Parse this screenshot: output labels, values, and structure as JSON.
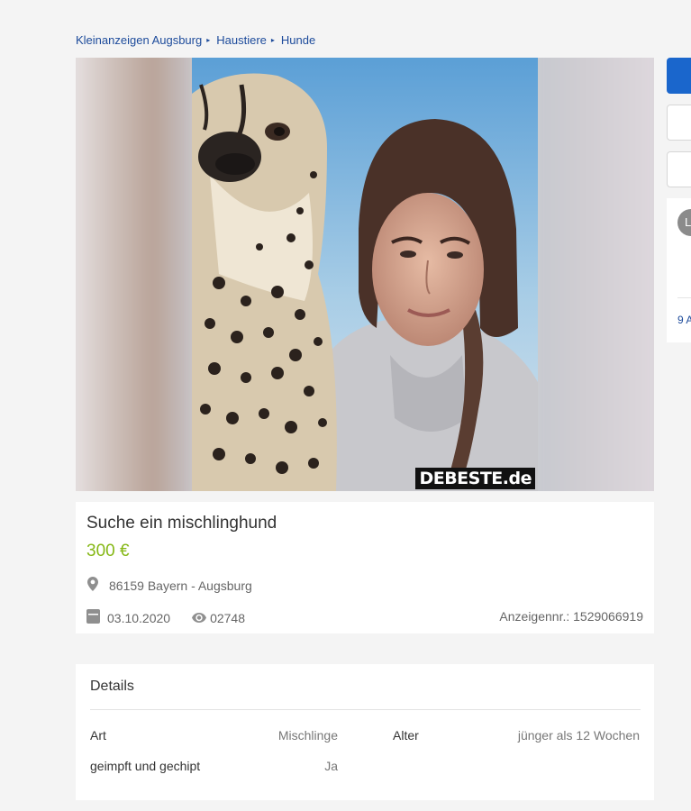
{
  "breadcrumb": {
    "items": [
      "Kleinanzeigen Augsburg",
      "Haustiere",
      "Hunde"
    ],
    "separator": "▸"
  },
  "gallery": {
    "watermark": "DEBESTE.de"
  },
  "sidebar": {
    "seller_initial": "L",
    "seller_link": "9 A"
  },
  "listing": {
    "title": "Suche ein mischlinghund",
    "price": "300 €",
    "location": "86159 Bayern - Augsburg",
    "date": "03.10.2020",
    "views": "02748",
    "ad_number": "Anzeigennr.: 1529066919"
  },
  "details": {
    "heading": "Details",
    "rows": [
      {
        "key": "Art",
        "value": "Mischlinge"
      },
      {
        "key": "Alter",
        "value": "jünger als 12 Wochen"
      },
      {
        "key": "geimpft und gechipt",
        "value": "Ja"
      }
    ]
  },
  "colors": {
    "link": "#1d4b9b",
    "price": "#86b817",
    "primary_button": "#1a66cc",
    "background": "#f4f4f4"
  },
  "icons": {
    "location": "map-pin-icon",
    "date": "calendar-icon",
    "views": "eye-icon",
    "breadcrumb_separator": "triangle-right-icon"
  }
}
